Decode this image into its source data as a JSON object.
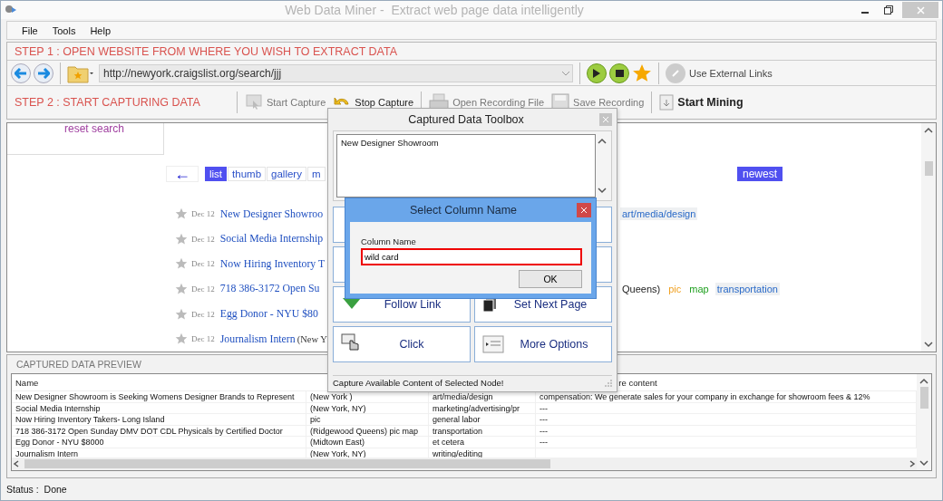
{
  "window": {
    "title": "Web Data Miner -  Extract web page data intelligently"
  },
  "menu": [
    {
      "label": "File"
    },
    {
      "label": "Tools"
    },
    {
      "label": "Help"
    }
  ],
  "step1": {
    "label": "STEP 1 : OPEN WEBSITE FROM WHERE YOU WISH TO EXTRACT DATA",
    "address": "http://newyork.craigslist.org/search/jjj",
    "external_links": "Use External Links"
  },
  "step2": {
    "label": "STEP 2 : START CAPTURING DATA",
    "tools": [
      {
        "label": "Start Capture",
        "kind": "start",
        "disabled": true
      },
      {
        "label": "Stop Capture",
        "kind": "stop",
        "disabled": false
      },
      {
        "label": "Open Recording File",
        "kind": "open",
        "disabled": true
      },
      {
        "label": "Save Recording",
        "kind": "save",
        "disabled": true
      },
      {
        "label": "Start Mining",
        "kind": "mine",
        "disabled": false
      }
    ]
  },
  "browser": {
    "reset": "reset search",
    "back": "←",
    "sort": "newest",
    "views": [
      {
        "label": "list",
        "selected": true
      },
      {
        "label": "thumb",
        "selected": false
      },
      {
        "label": "gallery",
        "selected": false
      },
      {
        "label": "m",
        "selected": false
      }
    ],
    "listings": [
      {
        "date": "Dec 12",
        "title": "New Designer Showroo",
        "extras": [
          {
            "kind": "tag",
            "text": "art/media/design"
          }
        ]
      },
      {
        "date": "Dec 12",
        "title": "Social Media Internship"
      },
      {
        "date": "Dec 12",
        "title": "Now Hiring Inventory T"
      },
      {
        "date": "Dec 12",
        "title": "718 386-3172 Open Su",
        "extras": [
          {
            "kind": "plain",
            "text": "Queens)"
          },
          {
            "kind": "pic",
            "text": "pic"
          },
          {
            "kind": "map",
            "text": "map"
          },
          {
            "kind": "tag",
            "text": "transportation"
          }
        ]
      },
      {
        "date": "Dec 12",
        "title": "Egg Donor - NYU $80"
      },
      {
        "date": "Dec 12",
        "title": "Journalism Intern",
        "suffix": "(New Y"
      }
    ]
  },
  "preview": {
    "title": "CAPTURED DATA PREVIEW",
    "header": {
      "column_1": "Name",
      "column_4": "re content"
    },
    "rows": [
      [
        "New Designer Showroom is Seeking Womens Designer Brands to Represent",
        "(New York )",
        "art/media/design",
        "compensation: We generate sales for your company in exchange for showroom fees & 12%"
      ],
      [
        "Social Media Internship",
        "(New York, NY)",
        "marketing/advertising/pr",
        "---"
      ],
      [
        "Now Hiring Inventory Takers- Long Island",
        "pic",
        "general labor",
        "---"
      ],
      [
        "718 386-3172 Open Sunday DMV DOT CDL Physicals by Certified Doctor",
        "(Ridgewood Queens) pic map",
        "transportation",
        "---"
      ],
      [
        "Egg Donor - NYU $8000",
        "(Midtown East)",
        "et cetera",
        "---"
      ],
      [
        "Journalism Intern",
        "(New York, NY)",
        "writing/editing"
      ]
    ]
  },
  "toolbox": {
    "title": "Captured Data Toolbox",
    "captured": "New Designer Showroom",
    "actions": [
      {
        "label": "Follow Link",
        "kind": "follow"
      },
      {
        "label": "Set Next Page",
        "kind": "next"
      },
      {
        "label": "Click",
        "kind": "click"
      },
      {
        "label": "More Options",
        "kind": "more"
      }
    ],
    "status": "Capture Available Content of Selected Node!"
  },
  "dialog": {
    "title": "Select Column Name",
    "field_label": "Column Name",
    "value": "wild card",
    "button": "OK"
  },
  "status": {
    "label": "Status :",
    "value": "Done"
  }
}
